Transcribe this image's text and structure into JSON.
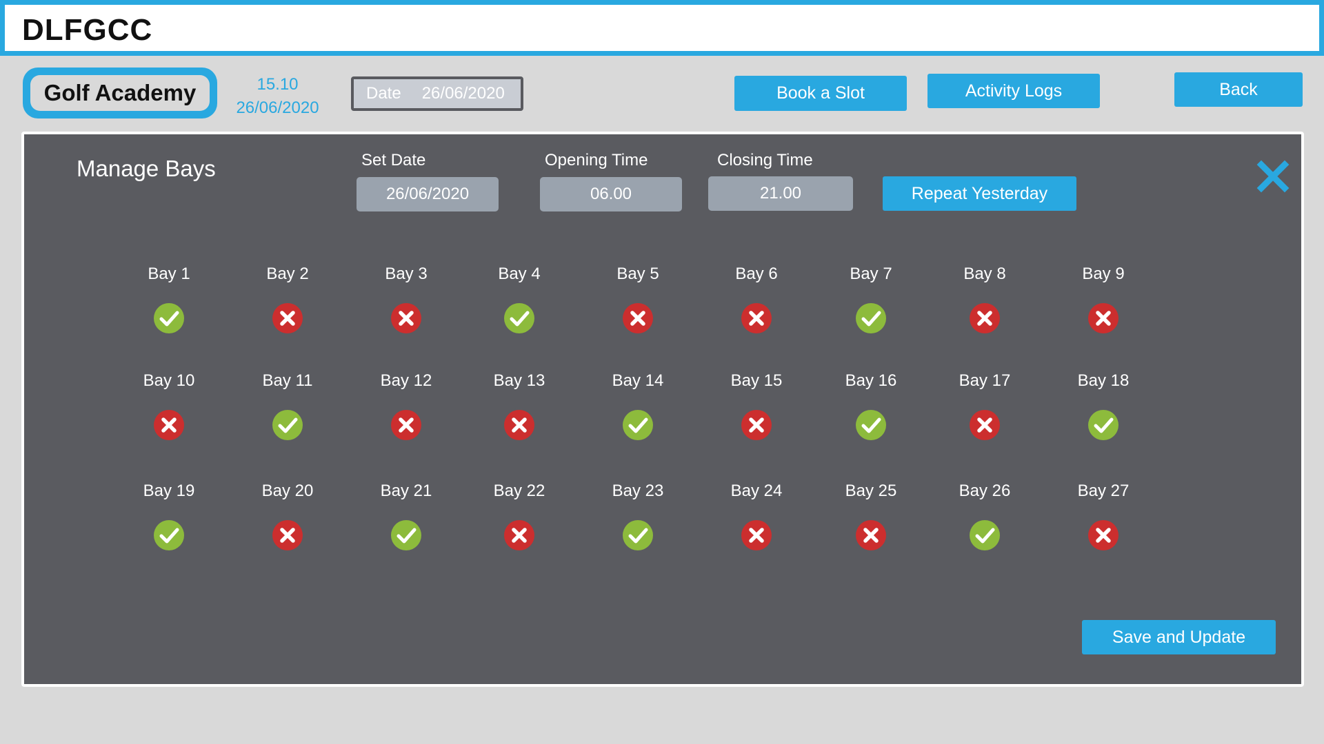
{
  "app": {
    "title": "DLFGCC"
  },
  "header": {
    "academy": "Golf Academy",
    "time": "15.10",
    "date": "26/06/2020",
    "date_field": {
      "label": "Date",
      "value": "26/06/2020"
    },
    "buttons": {
      "book": "Book a Slot",
      "activity": "Activity Logs",
      "back": "Back"
    }
  },
  "panel": {
    "title": "Manage Bays",
    "set_date": {
      "label": "Set Date",
      "value": "26/06/2020"
    },
    "opening": {
      "label": "Opening Time",
      "value": "06.00"
    },
    "closing": {
      "label": "Closing Time",
      "value": "21.00"
    },
    "repeat_label": "Repeat Yesterday",
    "save_label": "Save and Update",
    "colors": {
      "available": "#8dbb3c",
      "unavailable": "#cc2e2e",
      "accent": "#29a8e0"
    },
    "bays": [
      {
        "label": "Bay 1",
        "available": true
      },
      {
        "label": "Bay 2",
        "available": false
      },
      {
        "label": "Bay 3",
        "available": false
      },
      {
        "label": "Bay 4",
        "available": true
      },
      {
        "label": "Bay 5",
        "available": false
      },
      {
        "label": "Bay 6",
        "available": false
      },
      {
        "label": "Bay 7",
        "available": true
      },
      {
        "label": "Bay 8",
        "available": false
      },
      {
        "label": "Bay 9",
        "available": false
      },
      {
        "label": "Bay 10",
        "available": false
      },
      {
        "label": "Bay 11",
        "available": true
      },
      {
        "label": "Bay 12",
        "available": false
      },
      {
        "label": "Bay 13",
        "available": false
      },
      {
        "label": "Bay 14",
        "available": true
      },
      {
        "label": "Bay 15",
        "available": false
      },
      {
        "label": "Bay 16",
        "available": true
      },
      {
        "label": "Bay 17",
        "available": false
      },
      {
        "label": "Bay 18",
        "available": true
      },
      {
        "label": "Bay 19",
        "available": true
      },
      {
        "label": "Bay 20",
        "available": false
      },
      {
        "label": "Bay 21",
        "available": true
      },
      {
        "label": "Bay 22",
        "available": false
      },
      {
        "label": "Bay 23",
        "available": true
      },
      {
        "label": "Bay 24",
        "available": false
      },
      {
        "label": "Bay 25",
        "available": false
      },
      {
        "label": "Bay 26",
        "available": true
      },
      {
        "label": "Bay 27",
        "available": false
      }
    ]
  }
}
